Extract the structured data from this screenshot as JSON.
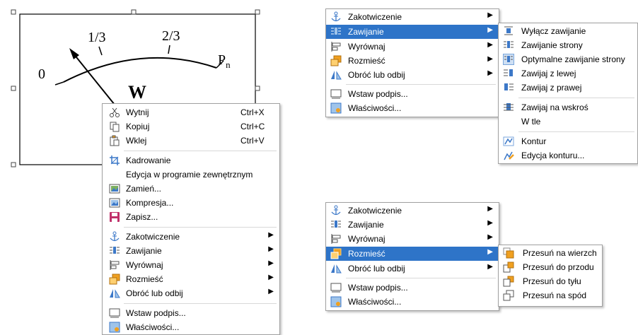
{
  "gauge": {
    "label_zero": "0",
    "label_one_third": "1/3",
    "label_two_thirds": "2/3",
    "label_p": "P",
    "label_p_sub": "n",
    "label_w": "W"
  },
  "context_menu": {
    "items": [
      {
        "label": "Wytnij",
        "shortcut": "Ctrl+X",
        "icon": "scissors-icon"
      },
      {
        "label": "Kopiuj",
        "shortcut": "Ctrl+C",
        "icon": "copy-icon"
      },
      {
        "label": "Wklej",
        "shortcut": "Ctrl+V",
        "icon": "paste-icon"
      },
      {
        "label": "Kadrowanie",
        "icon": "crop-icon"
      },
      {
        "label": "Edycja w programie zewnętrznym"
      },
      {
        "label": "Zamień...",
        "icon": "replace-image-icon"
      },
      {
        "label": "Kompresja...",
        "icon": "compress-icon"
      },
      {
        "label": "Zapisz...",
        "icon": "save-icon"
      },
      {
        "label": "Zakotwiczenie",
        "icon": "anchor-icon"
      },
      {
        "label": "Zawijanie",
        "icon": "wrap-icon"
      },
      {
        "label": "Wyrównaj",
        "icon": "align-icon"
      },
      {
        "label": "Rozmieść",
        "icon": "arrange-icon"
      },
      {
        "label": "Obróć lub odbij",
        "icon": "rotate-icon"
      },
      {
        "label": "Wstaw podpis...",
        "icon": "caption-icon"
      },
      {
        "label": "Właściwości...",
        "icon": "properties-icon"
      }
    ]
  },
  "menu_top_right": {
    "items": [
      {
        "label": "Zakotwiczenie",
        "icon": "anchor-icon"
      },
      {
        "label": "Zawijanie",
        "icon": "wrap-icon"
      },
      {
        "label": "Wyrównaj",
        "icon": "align-icon"
      },
      {
        "label": "Rozmieść",
        "icon": "arrange-icon"
      },
      {
        "label": "Obróć lub odbij",
        "icon": "rotate-icon"
      },
      {
        "label": "Wstaw podpis...",
        "icon": "caption-icon"
      },
      {
        "label": "Właściwości...",
        "icon": "properties-icon"
      }
    ],
    "highlighted": "Zawijanie"
  },
  "wrap_submenu": {
    "items": [
      {
        "label": "Wyłącz zawijanie",
        "icon": "wrap-off-icon"
      },
      {
        "label": "Zawijanie strony",
        "icon": "wrap-page-icon"
      },
      {
        "label": "Optymalne zawijanie strony",
        "icon": "wrap-optimal-icon"
      },
      {
        "label": "Zawijaj z lewej",
        "icon": "wrap-left-icon"
      },
      {
        "label": "Zawijaj z prawej",
        "icon": "wrap-right-icon"
      },
      {
        "label": "Zawijaj na wskroś",
        "icon": "wrap-through-icon"
      },
      {
        "label": "W tle"
      },
      {
        "label": "Kontur",
        "icon": "contour-icon"
      },
      {
        "label": "Edycja konturu...",
        "icon": "edit-contour-icon"
      }
    ]
  },
  "menu_bottom_right": {
    "items": [
      {
        "label": "Zakotwiczenie",
        "icon": "anchor-icon"
      },
      {
        "label": "Zawijanie",
        "icon": "wrap-icon"
      },
      {
        "label": "Wyrównaj",
        "icon": "align-icon"
      },
      {
        "label": "Rozmieść",
        "icon": "arrange-icon"
      },
      {
        "label": "Obróć lub odbij",
        "icon": "rotate-icon"
      },
      {
        "label": "Wstaw podpis...",
        "icon": "caption-icon"
      },
      {
        "label": "Właściwości...",
        "icon": "properties-icon"
      }
    ],
    "highlighted": "Rozmieść"
  },
  "arrange_submenu": {
    "items": [
      {
        "label": "Przesuń na wierzch",
        "icon": "bring-to-front-icon"
      },
      {
        "label": "Przesuń do przodu",
        "icon": "bring-forward-icon"
      },
      {
        "label": "Przesuń do tyłu",
        "icon": "send-backward-icon"
      },
      {
        "label": "Przesuń na spód",
        "icon": "send-to-back-icon"
      }
    ]
  },
  "colors": {
    "highlight": "#2e74c8",
    "icon_blue": "#3c78c8",
    "icon_orange": "#f0a020"
  }
}
